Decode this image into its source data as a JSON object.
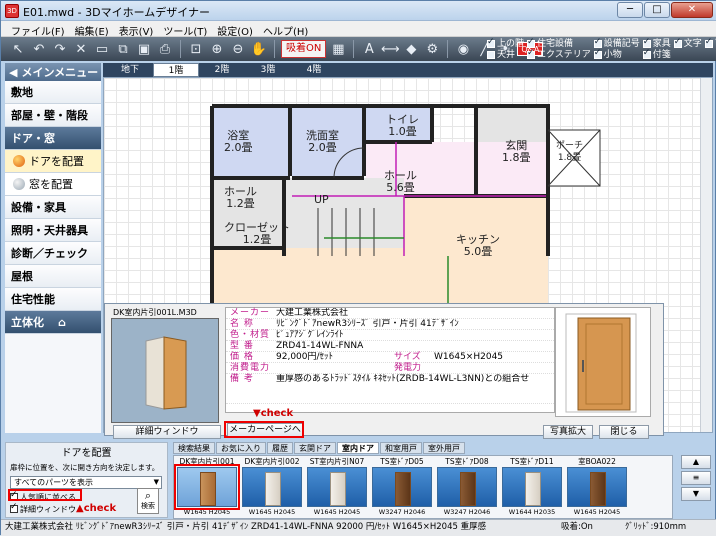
{
  "window": {
    "title": "E01.mwd - 3Dマイホームデザイナー",
    "app_icon_label": "3D"
  },
  "menu": [
    "ファイル(F)",
    "編集(E)",
    "表示(V)",
    "ツール(T)",
    "設定(O)",
    "ヘルプ(H)"
  ],
  "toolbar": {
    "snap_label": "吸着ON",
    "qna_label": "Q&A"
  },
  "display_options": [
    {
      "label": "上の階",
      "checked": true
    },
    {
      "label": "住宅設備",
      "checked": true
    },
    {
      "label": "設備記号",
      "checked": true
    },
    {
      "label": "家具",
      "checked": true
    },
    {
      "label": "文字",
      "checked": true
    },
    {
      "label": "下の階",
      "checked": true
    },
    {
      "label": "天井",
      "checked": false
    },
    {
      "label": "エクステリア",
      "checked": true
    },
    {
      "label": "小物",
      "checked": true
    },
    {
      "label": "付箋",
      "checked": true
    }
  ],
  "left_menu": {
    "header": "メインメニュー",
    "items": [
      "敷地",
      "部屋・壁・階段",
      "ドア・窓",
      "ドアを配置",
      "窓を配置",
      "設備・家具",
      "照明・天井器具",
      "診断／チェック",
      "屋根",
      "住宅性能",
      "立体化"
    ]
  },
  "floor_tabs": [
    "地下",
    "1階",
    "2階",
    "3階",
    "4階"
  ],
  "rooms": [
    {
      "name": "浴室",
      "size": "2.0畳"
    },
    {
      "name": "洗面室",
      "size": "2.0畳"
    },
    {
      "name": "トイレ",
      "size": "1.0畳"
    },
    {
      "name": "玄関",
      "size": "1.8畳"
    },
    {
      "name": "ポーチ",
      "size": "1.8畳"
    },
    {
      "name": "ホール",
      "size": "5.6畳"
    },
    {
      "name": "ホール",
      "size": "1.2畳"
    },
    {
      "name": "クローゼット",
      "size": "1.2畳"
    },
    {
      "name": "キッチン",
      "size": "5.0畳"
    }
  ],
  "stair_label": "UP",
  "detail": {
    "image_title": "DK室内片引001L.M3D",
    "specs": [
      {
        "key": "メーカー",
        "value": "大建工業株式会社"
      },
      {
        "key": "名 称",
        "value": "ﾘﾋﾞﾝｸﾞﾄﾞｱnewR3ｼﾘｰｽﾞ  引戸・片引 41ﾃﾞｻﾞｲﾝ"
      },
      {
        "key": "色・材質",
        "value": "ﾋﾟｭｱｱｼﾞｸﾞﾚｲﾝﾗｲﾄ"
      },
      {
        "key": "型 番",
        "value": "ZRD41-14WL-FNNA"
      },
      {
        "key": "価 格",
        "value": "92,000円/ｾｯﾄ",
        "key2": "サイズ",
        "value2": "W1645×H2045"
      },
      {
        "key": "消費電力",
        "value": "",
        "key2": "発電力",
        "value2": ""
      },
      {
        "key": "備 考",
        "value": "重厚感のあるﾄﾗｯﾄﾞｽﾀｲﾙ ｷﾈｾｯﾄ(ZRDB-14WL-L3NN)との組合せ"
      }
    ],
    "btn_detail": "詳細ウィンドウ",
    "btn_maker": "メーカーページへ",
    "btn_zoom": "写真拡大",
    "btn_close": "閉じる",
    "check_note": "▼check"
  },
  "place_panel": {
    "title": "ドアを配置",
    "description": "扉枠に位置を、次に開き方向を決定します。",
    "filter": "すべてのパーツを表示",
    "chk_favorite": "人気順に並べる",
    "chk_detail": "詳細ウィンドウ",
    "search": "検索",
    "check_note": "▲check"
  },
  "category_tabs": [
    "検索結果",
    "お気に入り",
    "履歴",
    "玄関ドア",
    "室内ドア",
    "和室用戸",
    "室外用戸"
  ],
  "parts": [
    {
      "name": "DK室内片引001",
      "size": "W1645 H2045",
      "tone": "wood"
    },
    {
      "name": "DK室内片引002",
      "size": "W1645 H2045",
      "tone": "white"
    },
    {
      "name": "ST室内片引N07",
      "size": "W1645 H2045",
      "tone": "white"
    },
    {
      "name": "TS室ﾄﾞｱD05",
      "size": "W3247 H2046",
      "tone": "dark"
    },
    {
      "name": "TS室ﾄﾞｱD08",
      "size": "W3247 H2046",
      "tone": "dark"
    },
    {
      "name": "TS室ﾄﾞｱD11",
      "size": "W1644 H2035",
      "tone": "white"
    },
    {
      "name": "室BOA022",
      "size": "W1645 H2045",
      "tone": "dark"
    }
  ],
  "status": {
    "left": "大建工業株式会社 ﾘﾋﾞﾝｸﾞﾄﾞｱnewR3ｼﾘｰｽﾞ 引戸・片引 41ﾃﾞｻﾞｲﾝ ZRD41-14WL-FNNA 92000 円/ｾｯﾄ W1645×H2045 重厚感",
    "snap": "吸着:On",
    "grid": "ｸﾞﾘｯﾄﾞ:910mm"
  }
}
